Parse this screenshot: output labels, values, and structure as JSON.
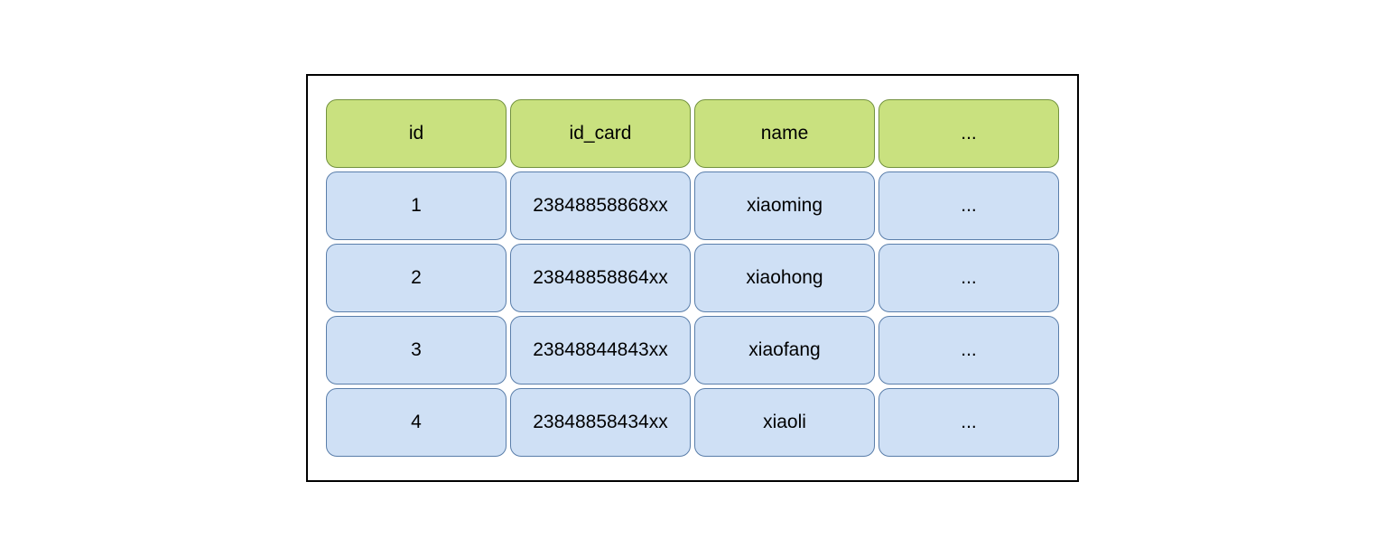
{
  "chart_data": {
    "type": "table",
    "columns": [
      "id",
      "id_card",
      "name",
      "..."
    ],
    "rows": [
      [
        "1",
        "23848858868xx",
        "xiaoming",
        "..."
      ],
      [
        "2",
        "23848858864xx",
        "xiaohong",
        "..."
      ],
      [
        "3",
        "23848844843xx",
        "xiaofang",
        "..."
      ],
      [
        "4",
        "23848858434xx",
        "xiaoli",
        "..."
      ]
    ]
  },
  "table": {
    "headers": {
      "c0": "id",
      "c1": "id_card",
      "c2": "name",
      "c3": "..."
    },
    "rows": {
      "r0": {
        "c0": "1",
        "c1": "23848858868xx",
        "c2": "xiaoming",
        "c3": "..."
      },
      "r1": {
        "c0": "2",
        "c1": "23848858864xx",
        "c2": "xiaohong",
        "c3": "..."
      },
      "r2": {
        "c0": "3",
        "c1": "23848844843xx",
        "c2": "xiaofang",
        "c3": "..."
      },
      "r3": {
        "c0": "4",
        "c1": "23848858434xx",
        "c2": "xiaoli",
        "c3": "..."
      }
    }
  },
  "colors": {
    "header_bg": "#c9e17f",
    "header_border": "#72913d",
    "data_bg": "#cfe0f5",
    "data_border": "#5a7eaa"
  }
}
